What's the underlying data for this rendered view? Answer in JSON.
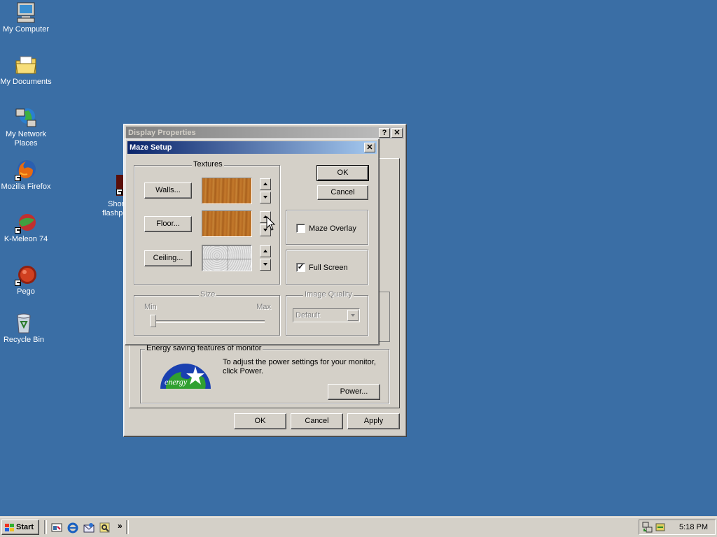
{
  "desktop": {
    "icons": [
      {
        "label": "My Computer",
        "icon": "my-computer-icon"
      },
      {
        "label": "My Documents",
        "icon": "my-documents-icon"
      },
      {
        "label": "My Network Places",
        "icon": "network-places-icon"
      },
      {
        "label": "Mozilla Firefox",
        "icon": "firefox-icon"
      },
      {
        "label": "K-Meleon 74",
        "icon": "k-meleon-icon"
      },
      {
        "label": "Pego",
        "icon": "pego-icon"
      },
      {
        "label": "Recycle Bin",
        "icon": "recycle-bin-icon"
      }
    ],
    "partial_icon": {
      "line1": "Shor",
      "line2": "flashp"
    }
  },
  "display_properties": {
    "title": "Display Properties",
    "help_label": "?",
    "close_label": "✕",
    "energy": {
      "legend": "Energy saving features of monitor",
      "text": "To adjust the power settings for your monitor, click Power.",
      "power_button": "Power...",
      "logo_text": "energy"
    },
    "buttons": {
      "ok": "OK",
      "cancel": "Cancel",
      "apply": "Apply"
    }
  },
  "maze_setup": {
    "title": "Maze Setup",
    "close_label": "✕",
    "textures": {
      "legend": "Textures",
      "walls_button": "Walls...",
      "floor_button": "Floor...",
      "ceiling_button": "Ceiling..."
    },
    "ok_button": "OK",
    "cancel_button": "Cancel",
    "maze_overlay": {
      "label": "Maze Overlay",
      "checked": false
    },
    "full_screen": {
      "label": "Full Screen",
      "checked": true,
      "mark": "✓"
    },
    "size": {
      "legend": "Size",
      "min_label": "Min",
      "max_label": "Max",
      "value": 0
    },
    "image_quality": {
      "legend": "Image Quality",
      "selected": "Default"
    }
  },
  "taskbar": {
    "start_label": "Start",
    "overflow": "»",
    "clock": "5:18 PM"
  },
  "colors": {
    "desktop": "#3a6ea5",
    "title_active": "#0a246a",
    "face": "#d4d0c8"
  }
}
